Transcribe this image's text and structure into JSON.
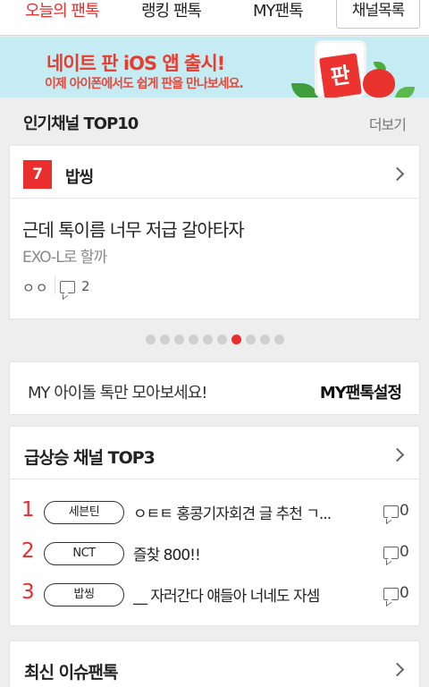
{
  "tabs": [
    {
      "label": "오늘의 팬톡",
      "active": true
    },
    {
      "label": "랭킹 팬톡",
      "active": false
    },
    {
      "label": "MY팬톡",
      "active": false
    }
  ],
  "channel_list_button": "채널목록",
  "banner": {
    "title": "네이트 판 iOS 앱 출시!",
    "subtitle": "이제 아이폰에서도 쉽게 판을 만나보세요.",
    "logo_text": "판"
  },
  "popular": {
    "title": "인기채널 TOP10",
    "more": "더보기",
    "rank": "7",
    "channel": "밥씽",
    "post_title": "근데 톡이름 너무 저급 갈아타자",
    "post_sub": "EXO-L로 할까",
    "author": "ㅇㅇ",
    "comments": "2",
    "slide_count": 10,
    "active_slide": 6
  },
  "my_idol": {
    "text": "MY 아이돌 톡만 모아보세요!",
    "button": "MY팬톡설정"
  },
  "rising": {
    "title": "급상승 채널 TOP3",
    "items": [
      {
        "rank": "1",
        "channel": "세븐틴",
        "title": "ㅇㅌㅌ 홍콩기자회견 글 추천 ㄱ...",
        "comments": "0"
      },
      {
        "rank": "2",
        "channel": "NCT",
        "title": "즐찾 800!!",
        "comments": "0"
      },
      {
        "rank": "3",
        "channel": "밥씽",
        "title": "__ 자러간다 얘들아 너네도 자셈",
        "comments": "0"
      }
    ]
  },
  "latest": {
    "title": "최신 이슈팬톡"
  },
  "colors": {
    "accent": "#ea2e2e",
    "banner_bg": "#c6ecf3",
    "page_bg": "#eeeeee"
  }
}
